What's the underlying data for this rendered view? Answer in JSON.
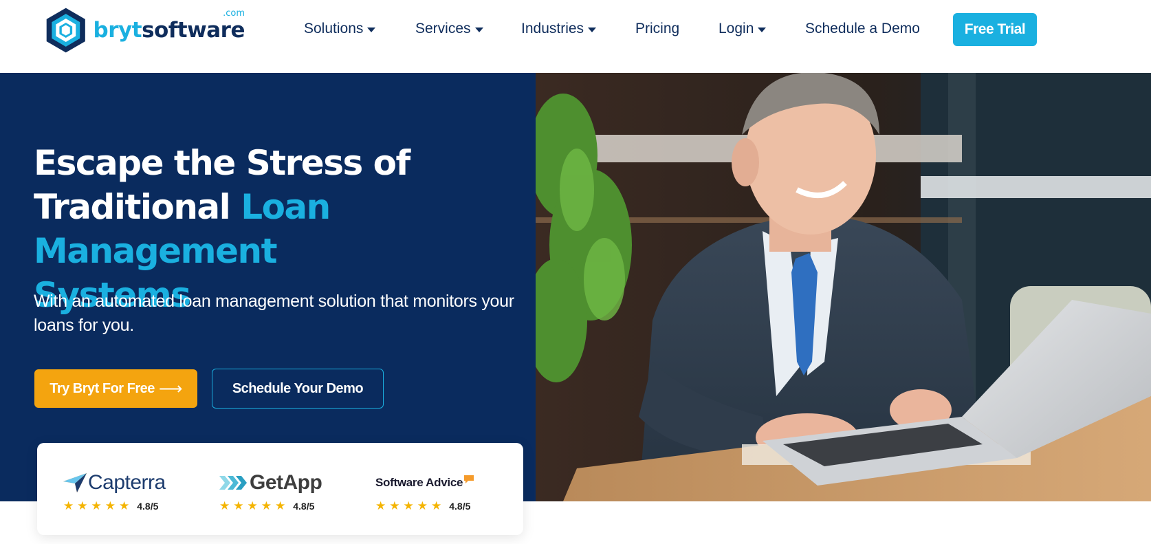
{
  "logo": {
    "part1": "bryt",
    "part2": "software",
    "tld": ".com"
  },
  "nav": {
    "items": [
      {
        "label": "Solutions",
        "has_dropdown": true
      },
      {
        "label": "Services",
        "has_dropdown": true
      },
      {
        "label": "Industries",
        "has_dropdown": true
      },
      {
        "label": "Pricing",
        "has_dropdown": false
      },
      {
        "label": "Login",
        "has_dropdown": true
      },
      {
        "label": "Schedule a Demo",
        "has_dropdown": false
      }
    ],
    "cta": "Free Trial"
  },
  "hero": {
    "title_line1": "Escape the Stress of",
    "title_line2_white": "Traditional ",
    "title_line2_accent": "Loan Management",
    "title_line3_accent": "Systems",
    "subtitle": "With an automated loan management solution that monitors your loans for you.",
    "primary_button": "Try Bryt For Free",
    "primary_arrow": "⟶",
    "secondary_button": "Schedule Your Demo"
  },
  "ratings": [
    {
      "brand": "Capterra",
      "icon": "capterra-arrow-icon",
      "score": "4.8/5",
      "stars": 5
    },
    {
      "brand": "GetApp",
      "icon": "getapp-chevrons-icon",
      "score": "4.8/5",
      "stars": 5
    },
    {
      "brand": "Software Advice",
      "icon": "software-advice-flag-icon",
      "score": "4.8/5",
      "stars": 5
    }
  ],
  "colors": {
    "navy": "#0a2b5e",
    "accent_blue": "#1ab0e0",
    "orange": "#f4a40f",
    "star": "#f4b400"
  }
}
